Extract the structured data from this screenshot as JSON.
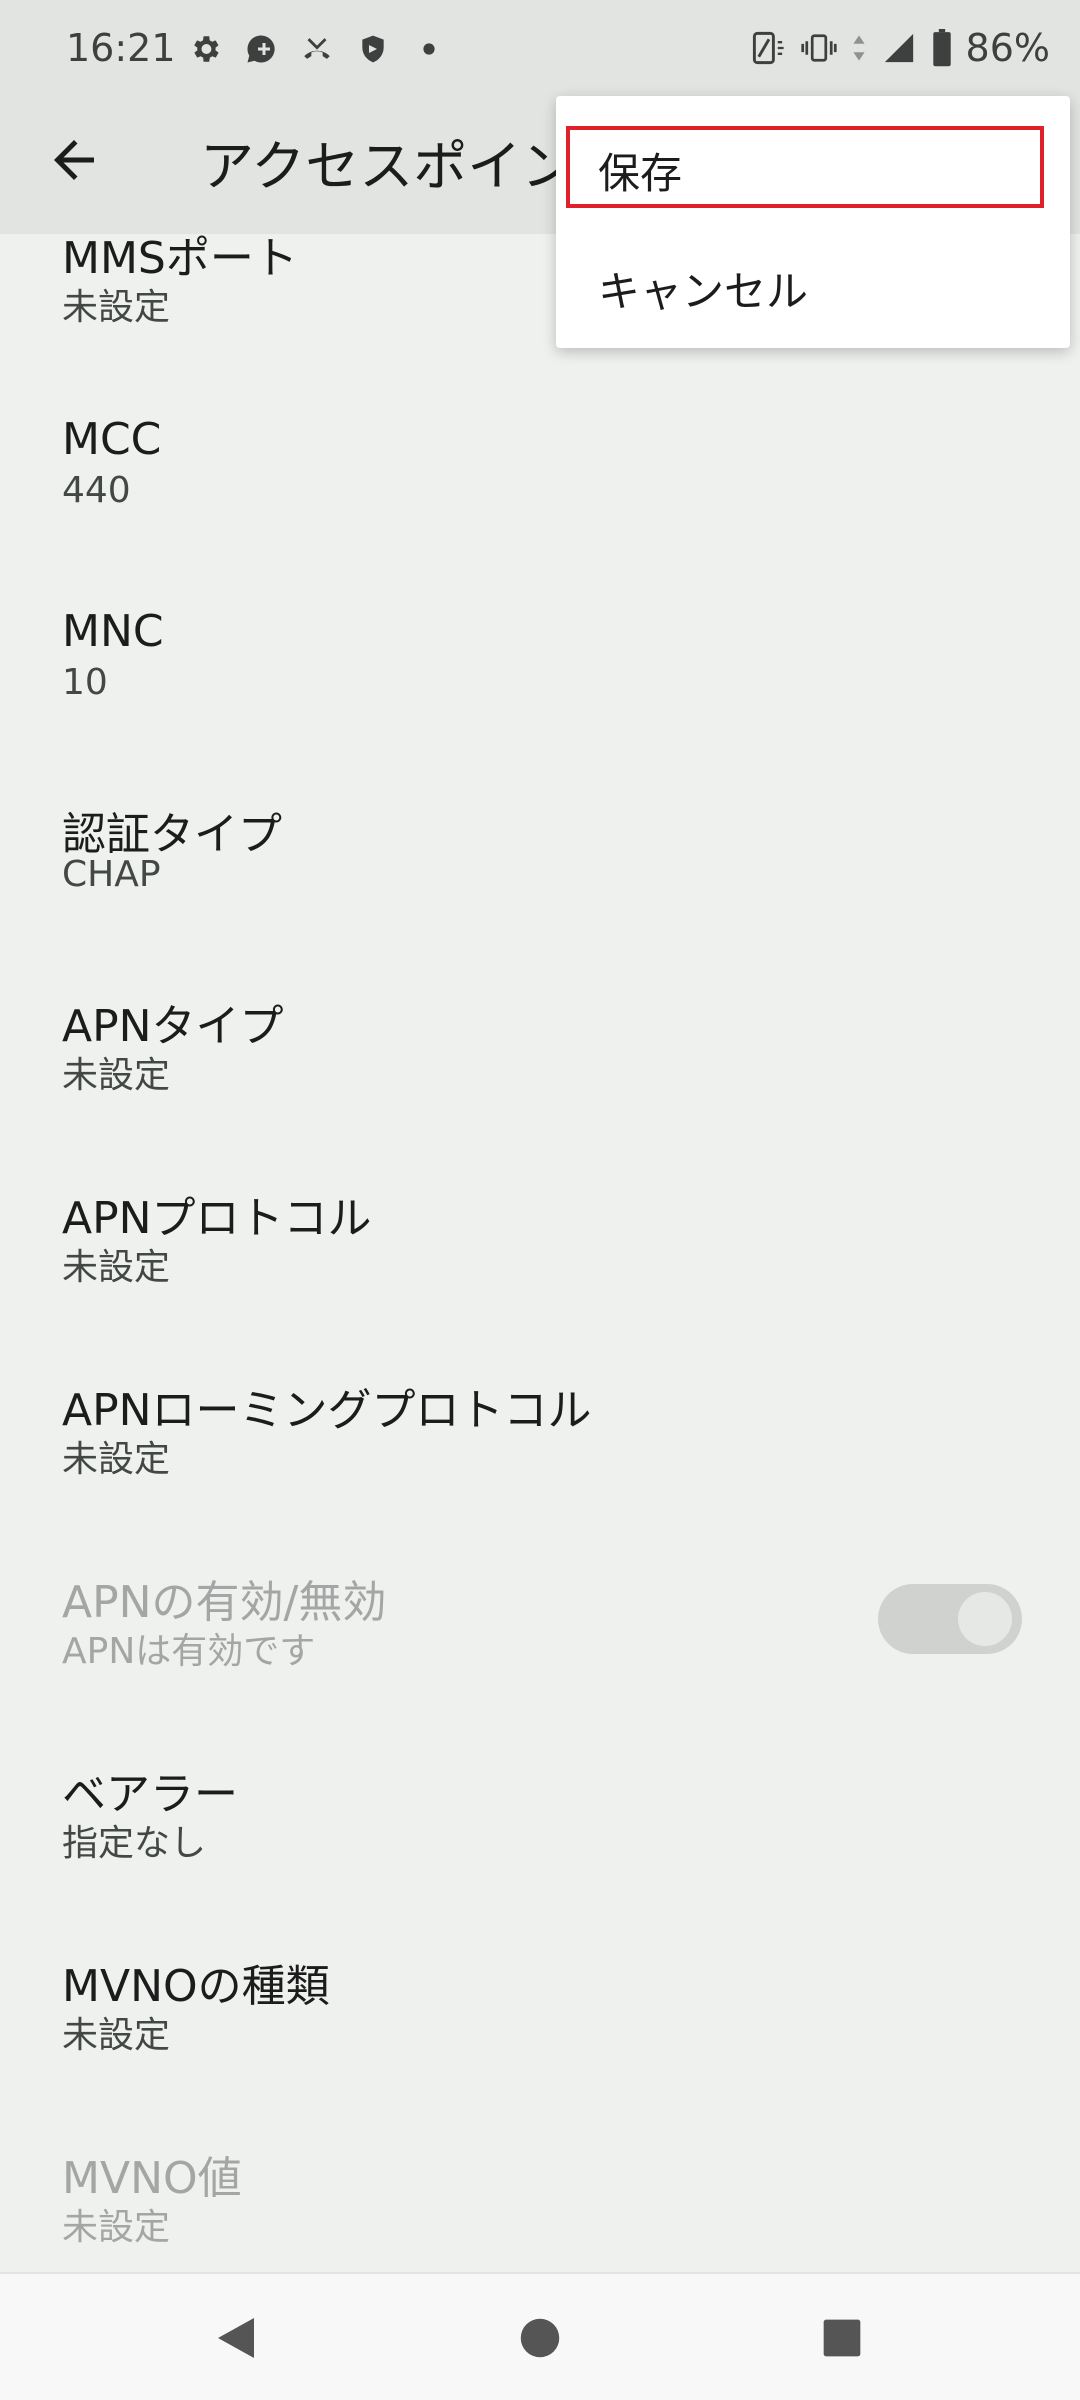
{
  "status_bar": {
    "time": "16:21",
    "left_icons": [
      "settings-icon",
      "chat-add-icon",
      "missed-call-icon",
      "shield-icon",
      "dot-icon"
    ],
    "right_icons": [
      "screen-rotate-icon",
      "vibrate-icon",
      "data-arrows-icon",
      "signal-icon",
      "battery-icon"
    ],
    "battery": "86%"
  },
  "toolbar": {
    "title": "アクセスポイン",
    "back_icon": "back-arrow-icon"
  },
  "menu": {
    "save_label": "保存",
    "cancel_label": "キャンセル",
    "highlight_color": "#e0202a"
  },
  "preferences": [
    {
      "title": "MMSポート",
      "summary": "未設定"
    },
    {
      "title": "MCC",
      "summary": "440"
    },
    {
      "title": "MNC",
      "summary": "10"
    },
    {
      "title": "認証タイプ",
      "summary": "CHAP"
    },
    {
      "title": "APNタイプ",
      "summary": "未設定"
    },
    {
      "title": "APNプロトコル",
      "summary": "未設定"
    },
    {
      "title": "APNローミングプロトコル",
      "summary": "未設定"
    },
    {
      "title": "APNの有効/無効",
      "summary": "APNは有効です",
      "enabled": false,
      "toggle_on": true
    },
    {
      "title": "ベアラー",
      "summary": "指定なし"
    },
    {
      "title": "MVNOの種類",
      "summary": "未設定"
    },
    {
      "title": "MVNO値",
      "summary": "未設定",
      "enabled": false
    }
  ],
  "nav_bar": {
    "back_icon": "nav-back-icon",
    "home_icon": "nav-home-icon",
    "recents_icon": "nav-recents-icon"
  }
}
